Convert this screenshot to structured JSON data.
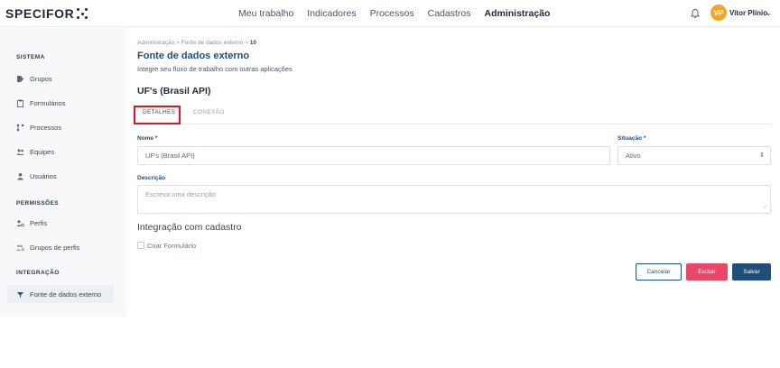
{
  "brand": {
    "logo_text": "SPECIFOR"
  },
  "nav": {
    "items": [
      "Meu trabalho",
      "Indicadores",
      "Processos",
      "Cadastros",
      "Administração"
    ],
    "active": "Administração"
  },
  "user": {
    "initials": "VP",
    "name": "Vitor Plínio",
    "avatar_color": "#f5a623"
  },
  "sidebar": {
    "sections": [
      {
        "title": "SISTEMA",
        "items": [
          {
            "label": "Grupos",
            "icon": "tag-icon"
          },
          {
            "label": "Formulários",
            "icon": "clipboard-icon"
          },
          {
            "label": "Processos",
            "icon": "process-flow-icon"
          },
          {
            "label": "Equipes",
            "icon": "team-icon"
          },
          {
            "label": "Usuários",
            "icon": "user-icon"
          }
        ]
      },
      {
        "title": "PERMISSÕES",
        "items": [
          {
            "label": "Perfis",
            "icon": "profile-gear-icon"
          },
          {
            "label": "Grupos de perfis",
            "icon": "profile-group-icon"
          }
        ]
      },
      {
        "title": "INTEGRAÇÃO",
        "items": [
          {
            "label": "Fonte de dados externo",
            "icon": "funnel-icon",
            "active": true
          }
        ]
      }
    ]
  },
  "breadcrumb": {
    "root": "Administração",
    "parent": "Fonte de dados externo",
    "current": "10",
    "separator": ">"
  },
  "page": {
    "title": "Fonte de dados externo",
    "subtitle": "Integre seu fluxo de trabalho com outras aplicações",
    "record_title": "UF's (Brasil API)"
  },
  "tabs": [
    {
      "label": "DETALHES",
      "active": true
    },
    {
      "label": "CONEXÃO",
      "active": false
    }
  ],
  "form": {
    "name_label": "Nome *",
    "name_value": "UF's (Brasil API)",
    "status_label": "Situação *",
    "status_value": "Ativo",
    "status_arrow": "⇕",
    "description_label": "Descrição",
    "description_placeholder": "Escreva uma descrição",
    "integration_title": "Integração com cadastro",
    "create_form_label": "Criar Formulário",
    "create_form_checked": false
  },
  "actions": {
    "cancel": "Cancelar",
    "delete": "Excluir",
    "save": "Salvar"
  },
  "colors": {
    "primary": "#1f4e79",
    "danger": "#e8476a",
    "highlight": "#e0161e"
  }
}
